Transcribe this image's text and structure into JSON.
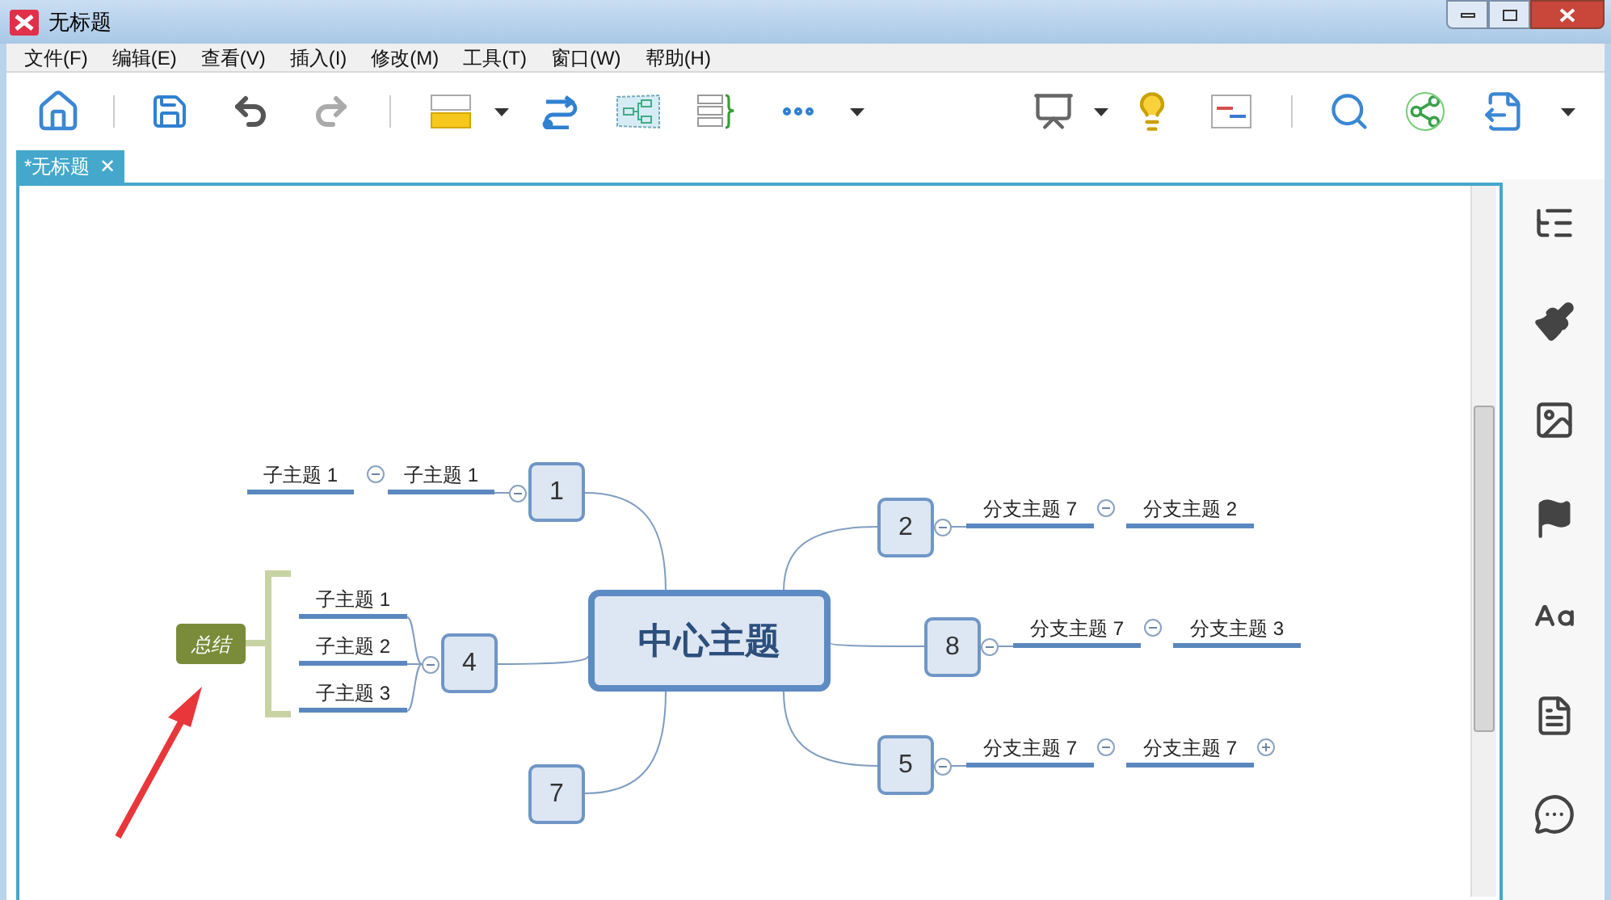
{
  "window": {
    "title": "无标题"
  },
  "menu": [
    "文件(F)",
    "编辑(E)",
    "查看(V)",
    "插入(I)",
    "修改(M)",
    "工具(T)",
    "窗口(W)",
    "帮助(H)"
  ],
  "tab": {
    "label": "*无标题",
    "close": "✕"
  },
  "map": {
    "central": "中心主题",
    "branches": [
      {
        "label": "1",
        "collapsed": false,
        "children": [
          {
            "label": "子主题 1",
            "collapsed": false,
            "children": [
              {
                "label": "子主题 1"
              }
            ]
          }
        ]
      },
      {
        "label": "4",
        "collapsed": false,
        "summary": {
          "label": "总结"
        },
        "children": [
          {
            "label": "子主题 1"
          },
          {
            "label": "子主题 2"
          },
          {
            "label": "子主题 3"
          }
        ]
      },
      {
        "label": "7"
      },
      {
        "label": "2",
        "collapsed": false,
        "children": [
          {
            "label": "分支主题 7",
            "collapsed": false,
            "children": [
              {
                "label": "分支主题 2"
              }
            ]
          }
        ]
      },
      {
        "label": "8",
        "collapsed": false,
        "children": [
          {
            "label": "分支主题 7",
            "collapsed": false,
            "children": [
              {
                "label": "分支主题 3"
              }
            ]
          }
        ]
      },
      {
        "label": "5",
        "collapsed": false,
        "children": [
          {
            "label": "分支主题 7",
            "collapsed": false,
            "children": [
              {
                "label": "分支主题 7",
                "collapsed": true
              }
            ]
          }
        ]
      }
    ]
  }
}
